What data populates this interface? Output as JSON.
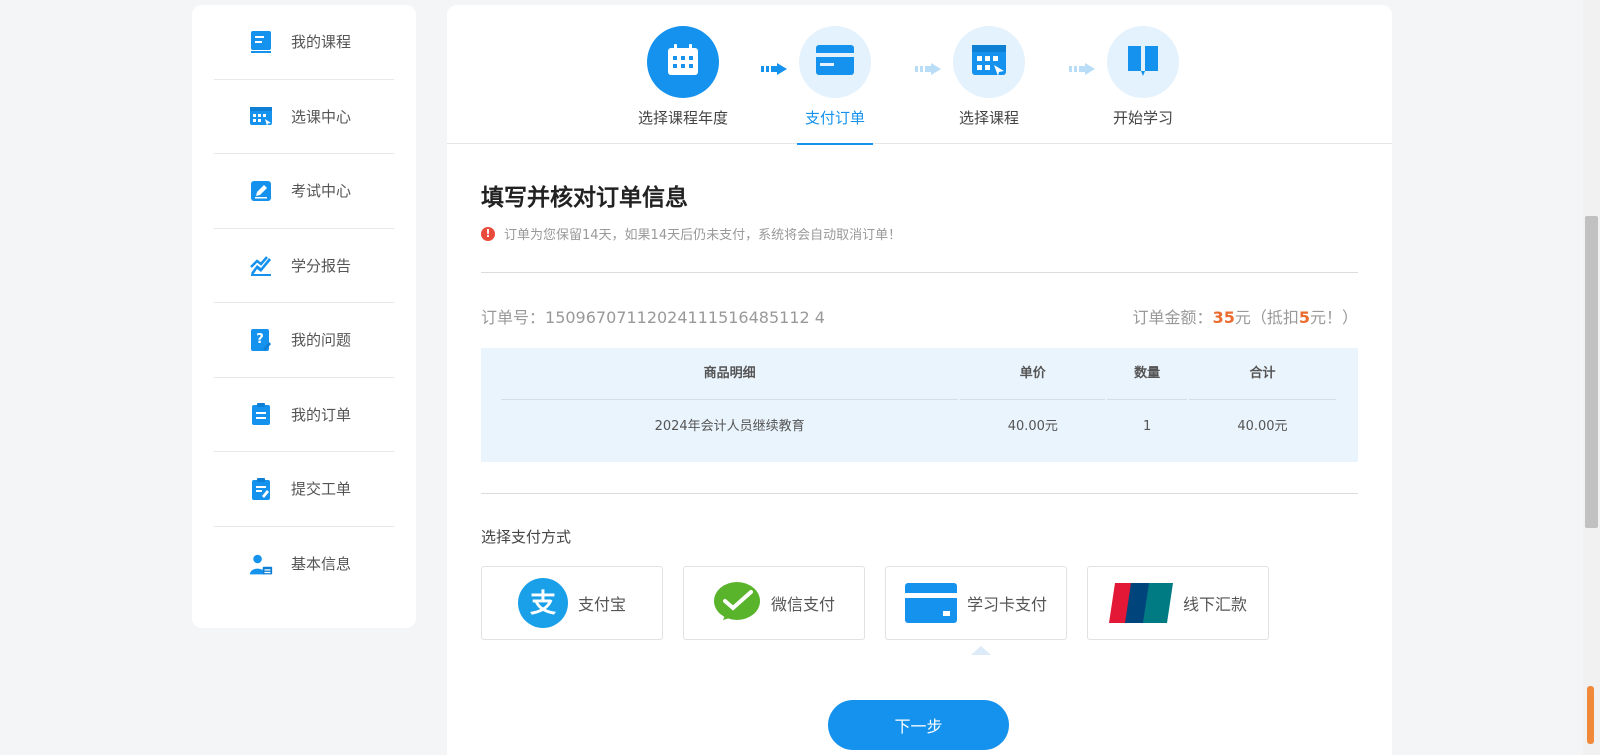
{
  "sidebar": {
    "items": [
      {
        "label": "我的课程",
        "icon": "book-icon"
      },
      {
        "label": "选课中心",
        "icon": "grid-select-icon"
      },
      {
        "label": "考试中心",
        "icon": "pen-edit-icon"
      },
      {
        "label": "学分报告",
        "icon": "chart-line-icon"
      },
      {
        "label": "我的问题",
        "icon": "question-doc-icon"
      },
      {
        "label": "我的订单",
        "icon": "clipboard-icon"
      },
      {
        "label": "提交工单",
        "icon": "ticket-icon"
      },
      {
        "label": "基本信息",
        "icon": "user-icon"
      }
    ]
  },
  "steps": [
    {
      "label": "选择课程年度",
      "icon": "calendar-icon",
      "state": "done"
    },
    {
      "label": "支付订单",
      "icon": "card-icon",
      "state": "active"
    },
    {
      "label": "选择课程",
      "icon": "grid-select-icon",
      "state": "todo"
    },
    {
      "label": "开始学习",
      "icon": "open-book-icon",
      "state": "todo"
    }
  ],
  "form": {
    "title": "填写并核对订单信息",
    "notice": "订单为您保留14天，如果14天后仍未支付，系统将会自动取消订单！",
    "order_no_label": "订单号：",
    "order_no": "15096707112024111516485112 4",
    "amount_label": "订单金额：",
    "amount": "35",
    "amount_unit": "元（抵扣",
    "discount": "5",
    "discount_unit": "元！）"
  },
  "goods": {
    "headers": [
      "商品明细",
      "单价",
      "数量",
      "合计"
    ],
    "rows": [
      [
        "2024年会计人员继续教育",
        "40.00元",
        "1",
        "40.00元"
      ]
    ]
  },
  "payment": {
    "title": "选择支付方式",
    "methods": [
      {
        "label": "支付宝",
        "icon": "alipay-icon"
      },
      {
        "label": "微信支付",
        "icon": "wechat-pay-icon"
      },
      {
        "label": "学习卡支付",
        "icon": "study-card-icon"
      },
      {
        "label": "线下汇款",
        "icon": "unionpay-icon"
      }
    ],
    "selected_index": 2
  },
  "next_button": "下一步",
  "colors": {
    "primary": "#1592ee",
    "accent": "#ea6c2f",
    "light": "#e4f2fd"
  }
}
